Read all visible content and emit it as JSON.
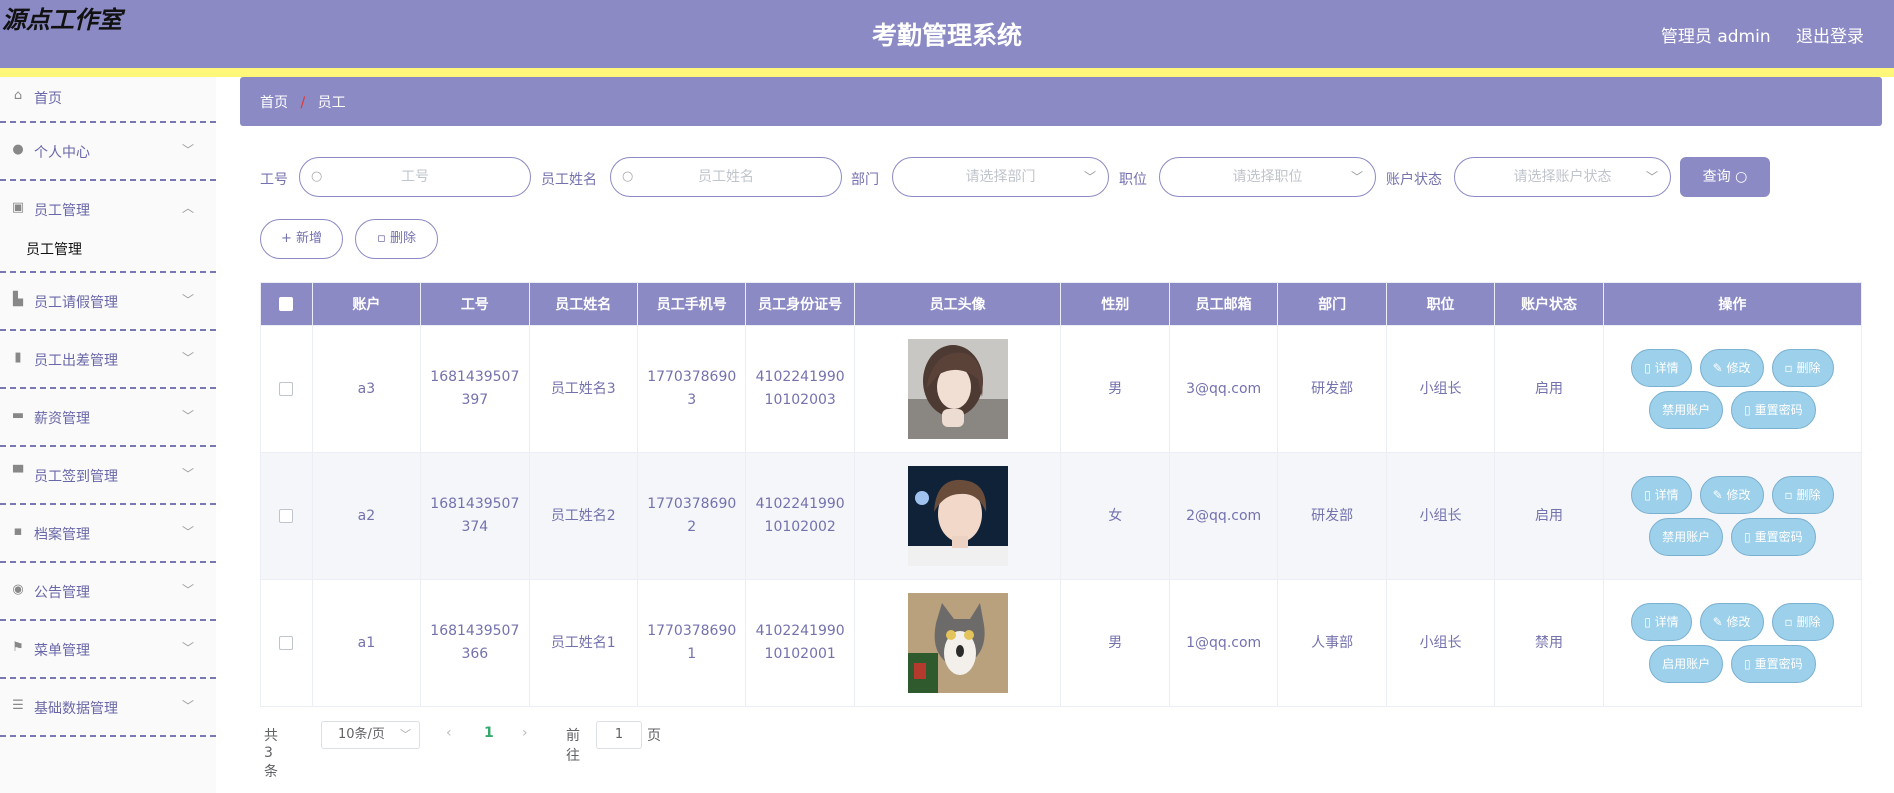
{
  "header": {
    "logo": "源点工作室",
    "title": "考勤管理系统",
    "user": "管理员 admin",
    "logout": "退出登录"
  },
  "sidebar": {
    "items": [
      {
        "label": "首页",
        "icon": "home-icon"
      },
      {
        "label": "个人中心",
        "icon": "user-icon"
      },
      {
        "label": "员工管理",
        "icon": "clipboard-icon"
      },
      {
        "label": "员工管理"
      },
      {
        "label": "员工请假管理",
        "icon": "briefcase-icon"
      },
      {
        "label": "员工出差管理",
        "icon": "building-icon"
      },
      {
        "label": "薪资管理",
        "icon": "wallet-icon"
      },
      {
        "label": "员工签到管理",
        "icon": "printer-icon"
      },
      {
        "label": "档案管理",
        "icon": "chat-icon"
      },
      {
        "label": "公告管理",
        "icon": "pin-icon"
      },
      {
        "label": "菜单管理",
        "icon": "flag-icon"
      },
      {
        "label": "基础数据管理",
        "icon": "sliders-icon"
      }
    ]
  },
  "breadcrumb": {
    "home": "首页",
    "sep": "/",
    "current": "员工"
  },
  "filters": {
    "gonghao_label": "工号",
    "gonghao_placeholder": "工号",
    "name_label": "员工姓名",
    "name_placeholder": "员工姓名",
    "dept_label": "部门",
    "dept_placeholder": "请选择部门",
    "pos_label": "职位",
    "pos_placeholder": "请选择职位",
    "status_label": "账户状态",
    "status_placeholder": "请选择账户状态",
    "query": "查询"
  },
  "actions": {
    "add": "+ 新增",
    "delete": "删除"
  },
  "table": {
    "headers": [
      "账户",
      "工号",
      "员工姓名",
      "员工手机号",
      "员工身份证号",
      "员工头像",
      "性别",
      "员工邮箱",
      "部门",
      "职位",
      "账户状态",
      "操作"
    ],
    "rows": [
      {
        "account": "a3",
        "gonghao_1": "1681439507",
        "gonghao_2": "397",
        "name": "员工姓名3",
        "phone_1": "1770378690",
        "phone_2": "3",
        "id_1": "4102241990",
        "id_2": "10102003",
        "gender": "男",
        "email": "3@qq.com",
        "dept": "研发部",
        "pos": "小组长",
        "status": "启用",
        "toggle": "禁用账户"
      },
      {
        "account": "a2",
        "gonghao_1": "1681439507",
        "gonghao_2": "374",
        "name": "员工姓名2",
        "phone_1": "1770378690",
        "phone_2": "2",
        "id_1": "4102241990",
        "id_2": "10102002",
        "gender": "女",
        "email": "2@qq.com",
        "dept": "研发部",
        "pos": "小组长",
        "status": "启用",
        "toggle": "禁用账户"
      },
      {
        "account": "a1",
        "gonghao_1": "1681439507",
        "gonghao_2": "366",
        "name": "员工姓名1",
        "phone_1": "1770378690",
        "phone_2": "1",
        "id_1": "4102241990",
        "id_2": "10102001",
        "gender": "男",
        "email": "1@qq.com",
        "dept": "人事部",
        "pos": "小组长",
        "status": "禁用",
        "toggle": "启用账户"
      }
    ],
    "ops": {
      "detail": "详情",
      "edit": "修改",
      "delete": "删除",
      "reset": "重置密码"
    }
  },
  "pager": {
    "total": "共 3 条",
    "size": "10条/页",
    "page": "1",
    "goto": "前往",
    "goto_value": "1",
    "page_unit": "页"
  }
}
